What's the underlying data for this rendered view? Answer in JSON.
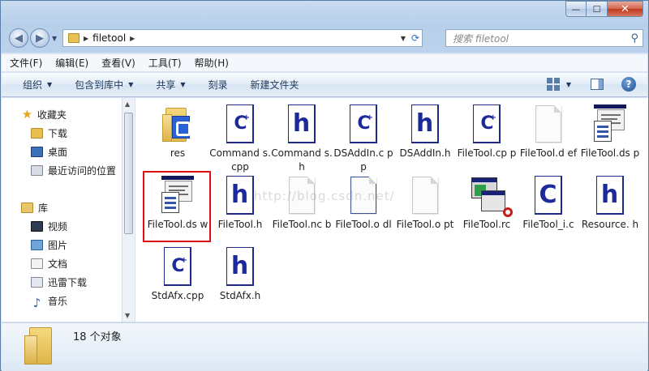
{
  "window": {
    "caption_min": "—",
    "caption_max": "☐",
    "caption_close": "✕"
  },
  "address": {
    "path": "filetool",
    "search_placeholder": "搜索 filetool"
  },
  "menu": [
    "文件(F)",
    "编辑(E)",
    "查看(V)",
    "工具(T)",
    "帮助(H)"
  ],
  "commands": [
    "组织",
    "包含到库中",
    "共享",
    "刻录",
    "新建文件夹"
  ],
  "nav": {
    "favorites": "收藏夹",
    "downloads": "下载",
    "desktop": "桌面",
    "recent": "最近访问的位置",
    "library": "库",
    "videos": "视频",
    "pictures": "图片",
    "documents": "文档",
    "thunder": "迅雷下载",
    "music": "音乐"
  },
  "files": [
    {
      "name": "res",
      "type": "folder"
    },
    {
      "name": "Command s.cpp",
      "type": "cpp"
    },
    {
      "name": "Command s.h",
      "type": "h"
    },
    {
      "name": "DSAddIn.c pp",
      "type": "cpp"
    },
    {
      "name": "DSAddIn.h",
      "type": "h"
    },
    {
      "name": "FileTool.cp p",
      "type": "cpp"
    },
    {
      "name": "FileTool.d ef",
      "type": "blank"
    },
    {
      "name": "FileTool.ds p",
      "type": "dsw"
    },
    {
      "name": "FileTool.ds w",
      "type": "dsw"
    },
    {
      "name": "FileTool.h",
      "type": "h"
    },
    {
      "name": "FileTool.nc b",
      "type": "blank"
    },
    {
      "name": "FileTool.o dl",
      "type": "doc"
    },
    {
      "name": "FileTool.o pt",
      "type": "blank"
    },
    {
      "name": "FileTool.rc",
      "type": "rc"
    },
    {
      "name": "FileTool_i.c",
      "type": "c"
    },
    {
      "name": "Resource. h",
      "type": "h"
    },
    {
      "name": "StdAfx.cpp",
      "type": "cpp"
    },
    {
      "name": "StdAfx.h",
      "type": "h"
    }
  ],
  "watermark": "http://blog.csdn.net/",
  "status": {
    "count": "18 个对象"
  }
}
